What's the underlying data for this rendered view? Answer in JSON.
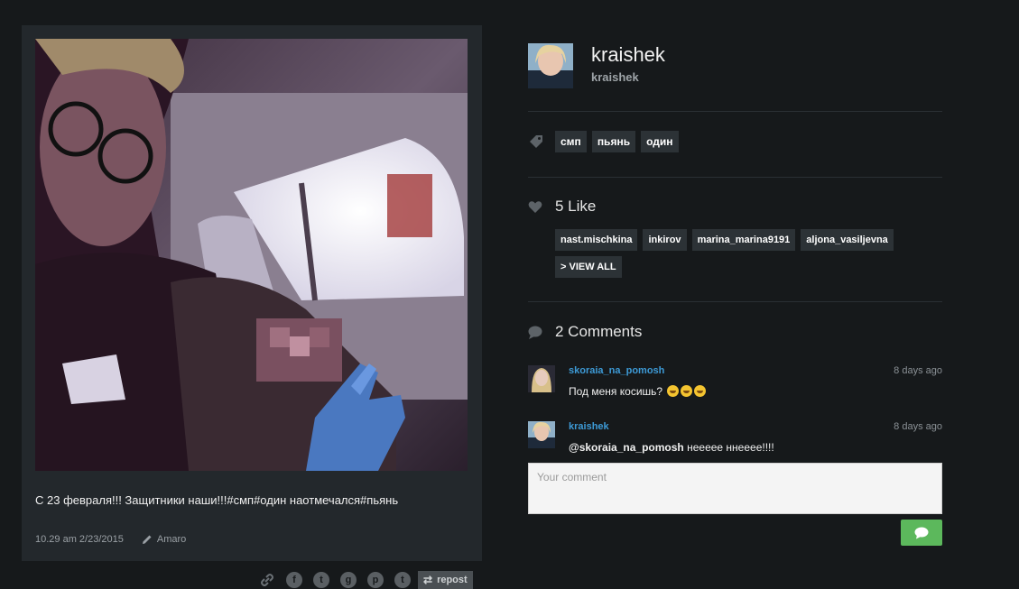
{
  "post": {
    "caption": "С 23 февраля!!! Защитники наши!!!#смп#один наотмечался#пьянь",
    "timestamp": "10.29 am 2/23/2015",
    "filter": "Amaro",
    "filter_icon": "pencil-icon"
  },
  "share": {
    "icons": [
      "link-icon",
      "facebook-icon",
      "twitter-icon",
      "vk-icon",
      "pinterest-icon",
      "tumblr-icon"
    ],
    "repost_label": "repost"
  },
  "profile": {
    "name": "kraishek",
    "handle": "kraishek"
  },
  "tags": {
    "icon": "tag-icon",
    "items": [
      "смп",
      "пьянь",
      "один"
    ]
  },
  "likes": {
    "icon": "heart-icon",
    "title": "5 Like",
    "users": [
      "nast.mischkina",
      "inkirov",
      "marina_marina9191",
      "aljona_vasiljevna"
    ],
    "view_all": "> VIEW ALL"
  },
  "comments": {
    "icon": "speech-bubble-icon",
    "title": "2 Comments",
    "items": [
      {
        "user": "skoraia_na_pomosh",
        "time": "8 days ago",
        "mention": "",
        "text": "Под меня косишь?",
        "emoji_count": 3
      },
      {
        "user": "kraishek",
        "time": "8 days ago",
        "mention": "@skoraia_na_pomosh",
        "text": "неееее ннееее!!!!",
        "emoji_count": 0
      }
    ],
    "input_placeholder": "Your comment",
    "send_icon": "speech-bubble-icon"
  },
  "colors": {
    "background": "#16191b",
    "card": "#23282c",
    "chip": "#2c3236",
    "link": "#3d9ad6",
    "send_button": "#5cb85c"
  }
}
